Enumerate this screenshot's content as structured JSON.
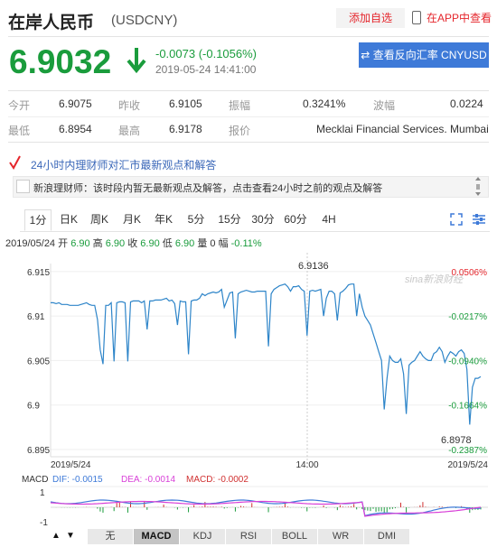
{
  "header": {
    "title": "在岸人民币",
    "code": "(USDCNY)",
    "add_fav": "添加自选",
    "app_view": "在APP中查看"
  },
  "quote": {
    "price": "6.9032",
    "change": "-0.0073 (-0.1056%)",
    "time": "2019-05-24 14:41:00",
    "reverse_btn": "查看反向汇率 CNYUSD"
  },
  "stats": {
    "row1": [
      {
        "label": "今开",
        "value": "6.9075"
      },
      {
        "label": "昨收",
        "value": "6.9105"
      },
      {
        "label": "振幅",
        "value": "0.3241%"
      },
      {
        "label": "波幅",
        "value": "0.0224"
      }
    ],
    "row2": [
      {
        "label": "最低",
        "value": "6.8954"
      },
      {
        "label": "最高",
        "value": "6.9178"
      },
      {
        "label": "报价",
        "value": "Mecklai Financial Services. Mumbai"
      }
    ]
  },
  "news": {
    "heading": "24小时内理财师对汇市最新观点和解答",
    "item": "新浪理财师：该时段内暂无最新观点及解答，点击查看24小时之前的观点及解答"
  },
  "tabs": [
    "1分",
    "日K",
    "周K",
    "月K",
    "年K",
    "5分",
    "15分",
    "30分",
    "60分",
    "4H"
  ],
  "ohlc": {
    "date": "2019/05/24",
    "open_label": "开",
    "open": "6.90",
    "high_label": "高",
    "high": "6.90",
    "close_label": "收",
    "close": "6.90",
    "low_label": "低",
    "low": "6.90",
    "vol_label": "量",
    "vol": "0",
    "amp_label": "幅",
    "amp": "-0.11%"
  },
  "chart_data": {
    "type": "line",
    "y_ticks": [
      "6.915",
      "6.91",
      "6.905",
      "6.9",
      "6.895"
    ],
    "pct_ticks": [
      "0.0506%",
      "-0.0217%",
      "-0.0940%",
      "-0.1664%",
      "-0.2387%"
    ],
    "x_ticks": [
      "2019/5/24",
      "14:00",
      "2019/5/24"
    ],
    "max_label": "6.9136",
    "min_label": "6.8978",
    "watermark": "sina新浪财经",
    "ylim": [
      6.895,
      6.916
    ],
    "values": [
      6.9115,
      6.9115,
      6.9114,
      6.9115,
      6.9113,
      6.9113,
      6.9113,
      6.9112,
      6.9112,
      6.9112,
      6.9112,
      6.9113,
      6.9114,
      6.9115,
      6.9113,
      6.9112,
      6.9112,
      6.9096,
      6.9062,
      6.9046,
      6.9112,
      6.9112,
      6.9115,
      6.9049,
      6.9115,
      6.9116,
      6.9116,
      6.9115,
      6.9049,
      6.9116,
      6.9117,
      6.9117,
      6.9117,
      6.9115,
      6.9117,
      6.9085,
      6.9117,
      6.9117,
      6.9118,
      6.9118,
      6.9118,
      6.9119,
      6.912,
      6.9117,
      6.9118,
      6.9114,
      6.909,
      6.9117,
      6.9116,
      6.9116,
      6.9057,
      6.9117,
      6.9118,
      6.9118,
      6.912,
      6.9125,
      6.9123,
      6.9125,
      6.9126,
      6.9127,
      6.9126,
      6.9127,
      6.913,
      6.911,
      6.9118,
      6.9126,
      6.9127,
      6.9075,
      6.9125,
      6.9127,
      6.9128,
      6.9129,
      6.9128,
      6.9127,
      6.9127,
      6.9128,
      6.9128,
      6.9128,
      6.9128,
      6.9066,
      6.9125,
      6.913,
      6.9132,
      6.9134,
      6.9135,
      6.9136,
      6.9133,
      6.9128,
      6.9133,
      6.9133,
      6.9134,
      6.913,
      6.9128,
      6.9078,
      6.9128,
      6.9129,
      6.9128,
      6.9129,
      6.913,
      6.91,
      6.912,
      6.9128,
      6.9128,
      6.9125,
      6.9095,
      6.9126,
      6.9128,
      6.9131,
      6.9135,
      6.9136,
      6.9136,
      6.91,
      6.9125,
      6.911,
      6.91,
      6.9095,
      6.909,
      6.908,
      6.907,
      6.906,
      6.905,
      6.8995,
      6.903,
      6.9055,
      6.905,
      6.9048,
      6.9048,
      6.9052,
      6.9035,
      6.899,
      6.9045,
      6.9048,
      6.905,
      6.9055,
      6.906,
      6.9055,
      6.9052,
      6.905,
      6.905,
      6.9058,
      6.906,
      6.9065,
      6.906,
      6.9048,
      6.9055,
      6.906,
      6.9058,
      6.9055,
      6.906,
      6.9062,
      6.9058,
      6.904,
      6.8978,
      6.902,
      6.903,
      6.903,
      6.9032
    ]
  },
  "macd": {
    "label": "MACD",
    "dif": "DIF: -0.0015",
    "dea": "DEA: -0.0014",
    "macd": "MACD: -0.0002",
    "y_ticks": [
      "1",
      "-1"
    ],
    "diff_color": "#3e7ad8",
    "dea_color": "#d840d8",
    "macd_color": "#d03030"
  },
  "indicator_tabs": [
    "无",
    "MACD",
    "KDJ",
    "RSI",
    "BOLL",
    "WR",
    "DMI"
  ]
}
